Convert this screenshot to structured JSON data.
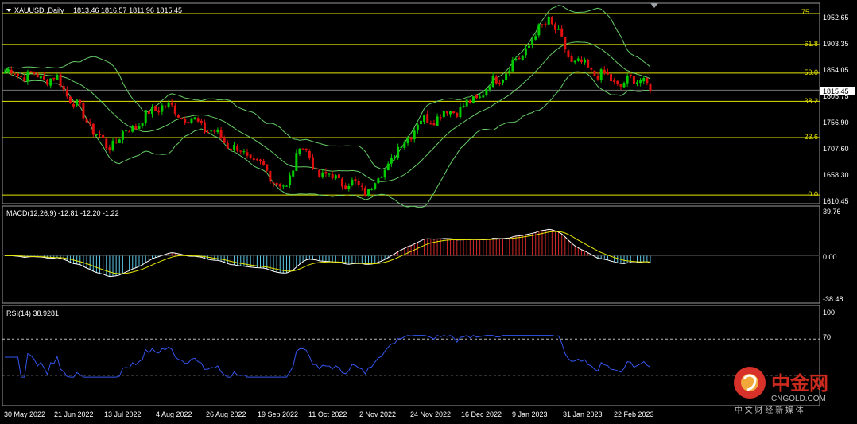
{
  "header": {
    "symbol": "XAUUSD.,Daily",
    "ohlc": "1813.46 1816.57 1811.96 1815.45"
  },
  "price_axis": {
    "ticks": [
      "1952.65",
      "1903.35",
      "1854.05",
      "1805.75",
      "1756.90",
      "1707.60",
      "1658.30",
      "1610.45"
    ],
    "current_price": "1815.45"
  },
  "fib_levels": [
    {
      "label": "75",
      "price": 1957
    },
    {
      "label": "61.8",
      "price": 1900
    },
    {
      "label": "50.0",
      "price": 1847
    },
    {
      "label": "38.2",
      "price": 1795
    },
    {
      "label": "23.6",
      "price": 1728
    },
    {
      "label": "0.0",
      "price": 1622
    }
  ],
  "macd": {
    "label": "MACD(12,26,9) -12.81 -12.20 -1.22",
    "ticks": [
      "39.76",
      "0.00",
      "-38.48"
    ]
  },
  "rsi": {
    "label": "RSI(14) 38.9281",
    "ticks": [
      "100",
      "70"
    ]
  },
  "x_axis": {
    "dates": [
      "30 May 2022",
      "21 Jun 2022",
      "13 Jul 2022",
      "4 Aug 2022",
      "26 Aug 2022",
      "19 Sep 2022",
      "11 Oct 2022",
      "2 Nov 2022",
      "24 Nov 2022",
      "16 Dec 2022",
      "9 Jan 2023",
      "31 Jan 2023",
      "22 Feb 2023"
    ]
  },
  "watermark": {
    "brand": "中金网",
    "site": "CNGOLD.COM",
    "tagline": "中 文 财 经 新 媒 体"
  },
  "colors": {
    "bull": "#00cc00",
    "bear": "#e01010",
    "bands": "#66cc66",
    "fib": "#e6e600",
    "macd_pos": "#d42828",
    "macd_neg": "#5cc8e6",
    "rsi": "#3355ee"
  },
  "chart_data": {
    "type": "candlestick",
    "title": "XAUUSD.,Daily",
    "series": [
      {
        "name": "XAUUSD",
        "close_path": [
          {
            "date": "30 May 2022",
            "price": 1850
          },
          {
            "date": "21 Jun 2022",
            "price": 1835
          },
          {
            "date": "13 Jul 2022",
            "price": 1710
          },
          {
            "date": "4 Aug 2022",
            "price": 1790
          },
          {
            "date": "26 Aug 2022",
            "price": 1740
          },
          {
            "date": "19 Sep 2022",
            "price": 1670
          },
          {
            "date": "28 Sep 2022",
            "price": 1630
          },
          {
            "date": "4 Oct 2022",
            "price": 1720
          },
          {
            "date": "11 Oct 2022",
            "price": 1665
          },
          {
            "date": "2 Nov 2022",
            "price": 1630
          },
          {
            "date": "24 Nov 2022",
            "price": 1755
          },
          {
            "date": "16 Dec 2022",
            "price": 1790
          },
          {
            "date": "9 Jan 2023",
            "price": 1875
          },
          {
            "date": "26 Jan 2023",
            "price": 1950
          },
          {
            "date": "31 Jan 2023",
            "price": 1925
          },
          {
            "date": "6 Feb 2023",
            "price": 1870
          },
          {
            "date": "22 Feb 2023",
            "price": 1825
          },
          {
            "date": "1 Mar 2023",
            "price": 1840
          },
          {
            "date": "3 Mar 2023",
            "price": 1815
          }
        ]
      }
    ],
    "ylim": [
      1610.45,
      1952.65
    ],
    "macd": {
      "value": -12.81,
      "signal": -12.2,
      "hist": -1.22,
      "ylim": [
        -38.48,
        39.76
      ]
    },
    "rsi": {
      "value": 38.9281,
      "levels": [
        30,
        70
      ],
      "ylim": [
        0,
        100
      ]
    }
  }
}
